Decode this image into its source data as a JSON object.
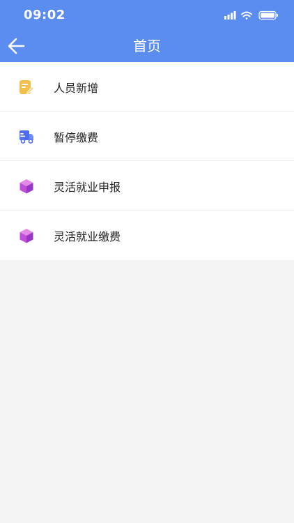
{
  "status_bar": {
    "time": "09:02"
  },
  "nav": {
    "title": "首页"
  },
  "menu": {
    "items": [
      {
        "label": "人员新增",
        "icon": "edit-note-icon"
      },
      {
        "label": "暂停缴费",
        "icon": "truck-icon"
      },
      {
        "label": "灵活就业申报",
        "icon": "cube-icon"
      },
      {
        "label": "灵活就业缴费",
        "icon": "cube-icon"
      }
    ]
  },
  "colors": {
    "header_bg": "#5b8df0",
    "page_bg": "#f4f4f4",
    "icon_yellow": "#f2c04a",
    "icon_blue": "#4f6cf0",
    "icon_purple": "#b24ed9"
  }
}
